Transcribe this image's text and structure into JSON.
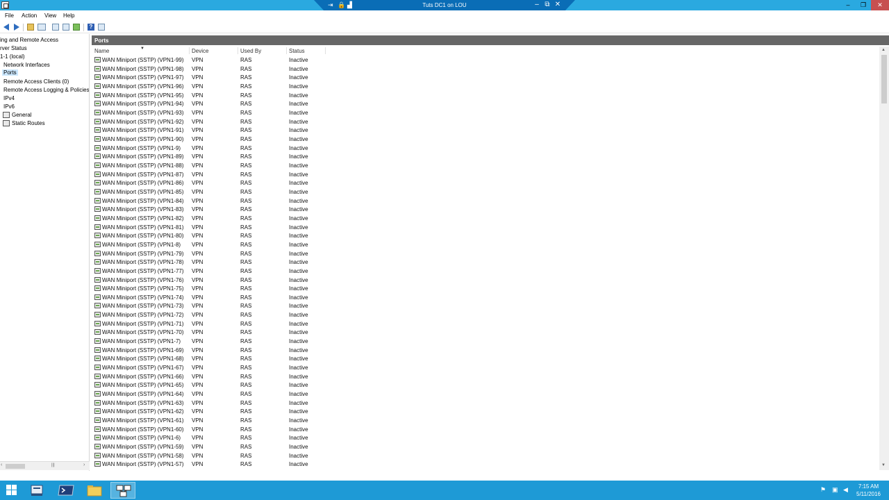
{
  "titlebar": {
    "rdp_title": "Tuts DC1 on LOU",
    "minimize": "–",
    "restore": "❐",
    "close": "✕",
    "rdp_pin": "⇥",
    "rdp_lock": "🔒",
    "rdp_signal": "▟",
    "rdp_min": "‒",
    "rdp_restore": "⧉",
    "rdp_close": "✕"
  },
  "menu": {
    "file": "File",
    "action": "Action",
    "view": "View",
    "help": "Help"
  },
  "toolbar": {
    "help_label": "?"
  },
  "tree": {
    "nodes": [
      {
        "label": "ing and Remote Access"
      },
      {
        "label": "rver Status"
      },
      {
        "label": "1-1 (local)"
      },
      {
        "label": "Network Interfaces"
      },
      {
        "label": "Ports"
      },
      {
        "label": "Remote Access Clients (0)"
      },
      {
        "label": "Remote Access Logging & Policies"
      },
      {
        "label": "IPv4"
      },
      {
        "label": "IPv6"
      },
      {
        "label": "General"
      },
      {
        "label": "Static Routes"
      }
    ],
    "scroll_left": "‹",
    "scroll_right": "›",
    "grip": "|||"
  },
  "pane": {
    "title": "Ports"
  },
  "columns": {
    "name": "Name",
    "device": "Device",
    "used_by": "Used By",
    "status": "Status",
    "sort_glyph": "▼"
  },
  "rows": [
    {
      "name": "WAN Miniport (SSTP) (VPN1-99)",
      "device": "VPN",
      "used_by": "RAS",
      "status": "Inactive"
    },
    {
      "name": "WAN Miniport (SSTP) (VPN1-98)",
      "device": "VPN",
      "used_by": "RAS",
      "status": "Inactive"
    },
    {
      "name": "WAN Miniport (SSTP) (VPN1-97)",
      "device": "VPN",
      "used_by": "RAS",
      "status": "Inactive"
    },
    {
      "name": "WAN Miniport (SSTP) (VPN1-96)",
      "device": "VPN",
      "used_by": "RAS",
      "status": "Inactive"
    },
    {
      "name": "WAN Miniport (SSTP) (VPN1-95)",
      "device": "VPN",
      "used_by": "RAS",
      "status": "Inactive"
    },
    {
      "name": "WAN Miniport (SSTP) (VPN1-94)",
      "device": "VPN",
      "used_by": "RAS",
      "status": "Inactive"
    },
    {
      "name": "WAN Miniport (SSTP) (VPN1-93)",
      "device": "VPN",
      "used_by": "RAS",
      "status": "Inactive"
    },
    {
      "name": "WAN Miniport (SSTP) (VPN1-92)",
      "device": "VPN",
      "used_by": "RAS",
      "status": "Inactive"
    },
    {
      "name": "WAN Miniport (SSTP) (VPN1-91)",
      "device": "VPN",
      "used_by": "RAS",
      "status": "Inactive"
    },
    {
      "name": "WAN Miniport (SSTP) (VPN1-90)",
      "device": "VPN",
      "used_by": "RAS",
      "status": "Inactive"
    },
    {
      "name": "WAN Miniport (SSTP) (VPN1-9)",
      "device": "VPN",
      "used_by": "RAS",
      "status": "Inactive"
    },
    {
      "name": "WAN Miniport (SSTP) (VPN1-89)",
      "device": "VPN",
      "used_by": "RAS",
      "status": "Inactive"
    },
    {
      "name": "WAN Miniport (SSTP) (VPN1-88)",
      "device": "VPN",
      "used_by": "RAS",
      "status": "Inactive"
    },
    {
      "name": "WAN Miniport (SSTP) (VPN1-87)",
      "device": "VPN",
      "used_by": "RAS",
      "status": "Inactive"
    },
    {
      "name": "WAN Miniport (SSTP) (VPN1-86)",
      "device": "VPN",
      "used_by": "RAS",
      "status": "Inactive"
    },
    {
      "name": "WAN Miniport (SSTP) (VPN1-85)",
      "device": "VPN",
      "used_by": "RAS",
      "status": "Inactive"
    },
    {
      "name": "WAN Miniport (SSTP) (VPN1-84)",
      "device": "VPN",
      "used_by": "RAS",
      "status": "Inactive"
    },
    {
      "name": "WAN Miniport (SSTP) (VPN1-83)",
      "device": "VPN",
      "used_by": "RAS",
      "status": "Inactive"
    },
    {
      "name": "WAN Miniport (SSTP) (VPN1-82)",
      "device": "VPN",
      "used_by": "RAS",
      "status": "Inactive"
    },
    {
      "name": "WAN Miniport (SSTP) (VPN1-81)",
      "device": "VPN",
      "used_by": "RAS",
      "status": "Inactive"
    },
    {
      "name": "WAN Miniport (SSTP) (VPN1-80)",
      "device": "VPN",
      "used_by": "RAS",
      "status": "Inactive"
    },
    {
      "name": "WAN Miniport (SSTP) (VPN1-8)",
      "device": "VPN",
      "used_by": "RAS",
      "status": "Inactive"
    },
    {
      "name": "WAN Miniport (SSTP) (VPN1-79)",
      "device": "VPN",
      "used_by": "RAS",
      "status": "Inactive"
    },
    {
      "name": "WAN Miniport (SSTP) (VPN1-78)",
      "device": "VPN",
      "used_by": "RAS",
      "status": "Inactive"
    },
    {
      "name": "WAN Miniport (SSTP) (VPN1-77)",
      "device": "VPN",
      "used_by": "RAS",
      "status": "Inactive"
    },
    {
      "name": "WAN Miniport (SSTP) (VPN1-76)",
      "device": "VPN",
      "used_by": "RAS",
      "status": "Inactive"
    },
    {
      "name": "WAN Miniport (SSTP) (VPN1-75)",
      "device": "VPN",
      "used_by": "RAS",
      "status": "Inactive"
    },
    {
      "name": "WAN Miniport (SSTP) (VPN1-74)",
      "device": "VPN",
      "used_by": "RAS",
      "status": "Inactive"
    },
    {
      "name": "WAN Miniport (SSTP) (VPN1-73)",
      "device": "VPN",
      "used_by": "RAS",
      "status": "Inactive"
    },
    {
      "name": "WAN Miniport (SSTP) (VPN1-72)",
      "device": "VPN",
      "used_by": "RAS",
      "status": "Inactive"
    },
    {
      "name": "WAN Miniport (SSTP) (VPN1-71)",
      "device": "VPN",
      "used_by": "RAS",
      "status": "Inactive"
    },
    {
      "name": "WAN Miniport (SSTP) (VPN1-70)",
      "device": "VPN",
      "used_by": "RAS",
      "status": "Inactive"
    },
    {
      "name": "WAN Miniport (SSTP) (VPN1-7)",
      "device": "VPN",
      "used_by": "RAS",
      "status": "Inactive"
    },
    {
      "name": "WAN Miniport (SSTP) (VPN1-69)",
      "device": "VPN",
      "used_by": "RAS",
      "status": "Inactive"
    },
    {
      "name": "WAN Miniport (SSTP) (VPN1-68)",
      "device": "VPN",
      "used_by": "RAS",
      "status": "Inactive"
    },
    {
      "name": "WAN Miniport (SSTP) (VPN1-67)",
      "device": "VPN",
      "used_by": "RAS",
      "status": "Inactive"
    },
    {
      "name": "WAN Miniport (SSTP) (VPN1-66)",
      "device": "VPN",
      "used_by": "RAS",
      "status": "Inactive"
    },
    {
      "name": "WAN Miniport (SSTP) (VPN1-65)",
      "device": "VPN",
      "used_by": "RAS",
      "status": "Inactive"
    },
    {
      "name": "WAN Miniport (SSTP) (VPN1-64)",
      "device": "VPN",
      "used_by": "RAS",
      "status": "Inactive"
    },
    {
      "name": "WAN Miniport (SSTP) (VPN1-63)",
      "device": "VPN",
      "used_by": "RAS",
      "status": "Inactive"
    },
    {
      "name": "WAN Miniport (SSTP) (VPN1-62)",
      "device": "VPN",
      "used_by": "RAS",
      "status": "Inactive"
    },
    {
      "name": "WAN Miniport (SSTP) (VPN1-61)",
      "device": "VPN",
      "used_by": "RAS",
      "status": "Inactive"
    },
    {
      "name": "WAN Miniport (SSTP) (VPN1-60)",
      "device": "VPN",
      "used_by": "RAS",
      "status": "Inactive"
    },
    {
      "name": "WAN Miniport (SSTP) (VPN1-6)",
      "device": "VPN",
      "used_by": "RAS",
      "status": "Inactive"
    },
    {
      "name": "WAN Miniport (SSTP) (VPN1-59)",
      "device": "VPN",
      "used_by": "RAS",
      "status": "Inactive"
    },
    {
      "name": "WAN Miniport (SSTP) (VPN1-58)",
      "device": "VPN",
      "used_by": "RAS",
      "status": "Inactive"
    },
    {
      "name": "WAN Miniport (SSTP) (VPN1-57)",
      "device": "VPN",
      "used_by": "RAS",
      "status": "Inactive"
    }
  ],
  "scrollbar": {
    "up": "▲",
    "down": "▼"
  },
  "taskbar": {
    "tray_flag": "⚑",
    "tray_network": "▣",
    "tray_volume": "◀",
    "time": "7:15 AM",
    "date": "5/11/2016"
  },
  "colors": {
    "titlebar": "#2aa9e0",
    "rdp_bar": "#0a6db6",
    "pane_header": "#676767",
    "selection": "#cce8ff",
    "taskbar": "#1e9ad6"
  }
}
